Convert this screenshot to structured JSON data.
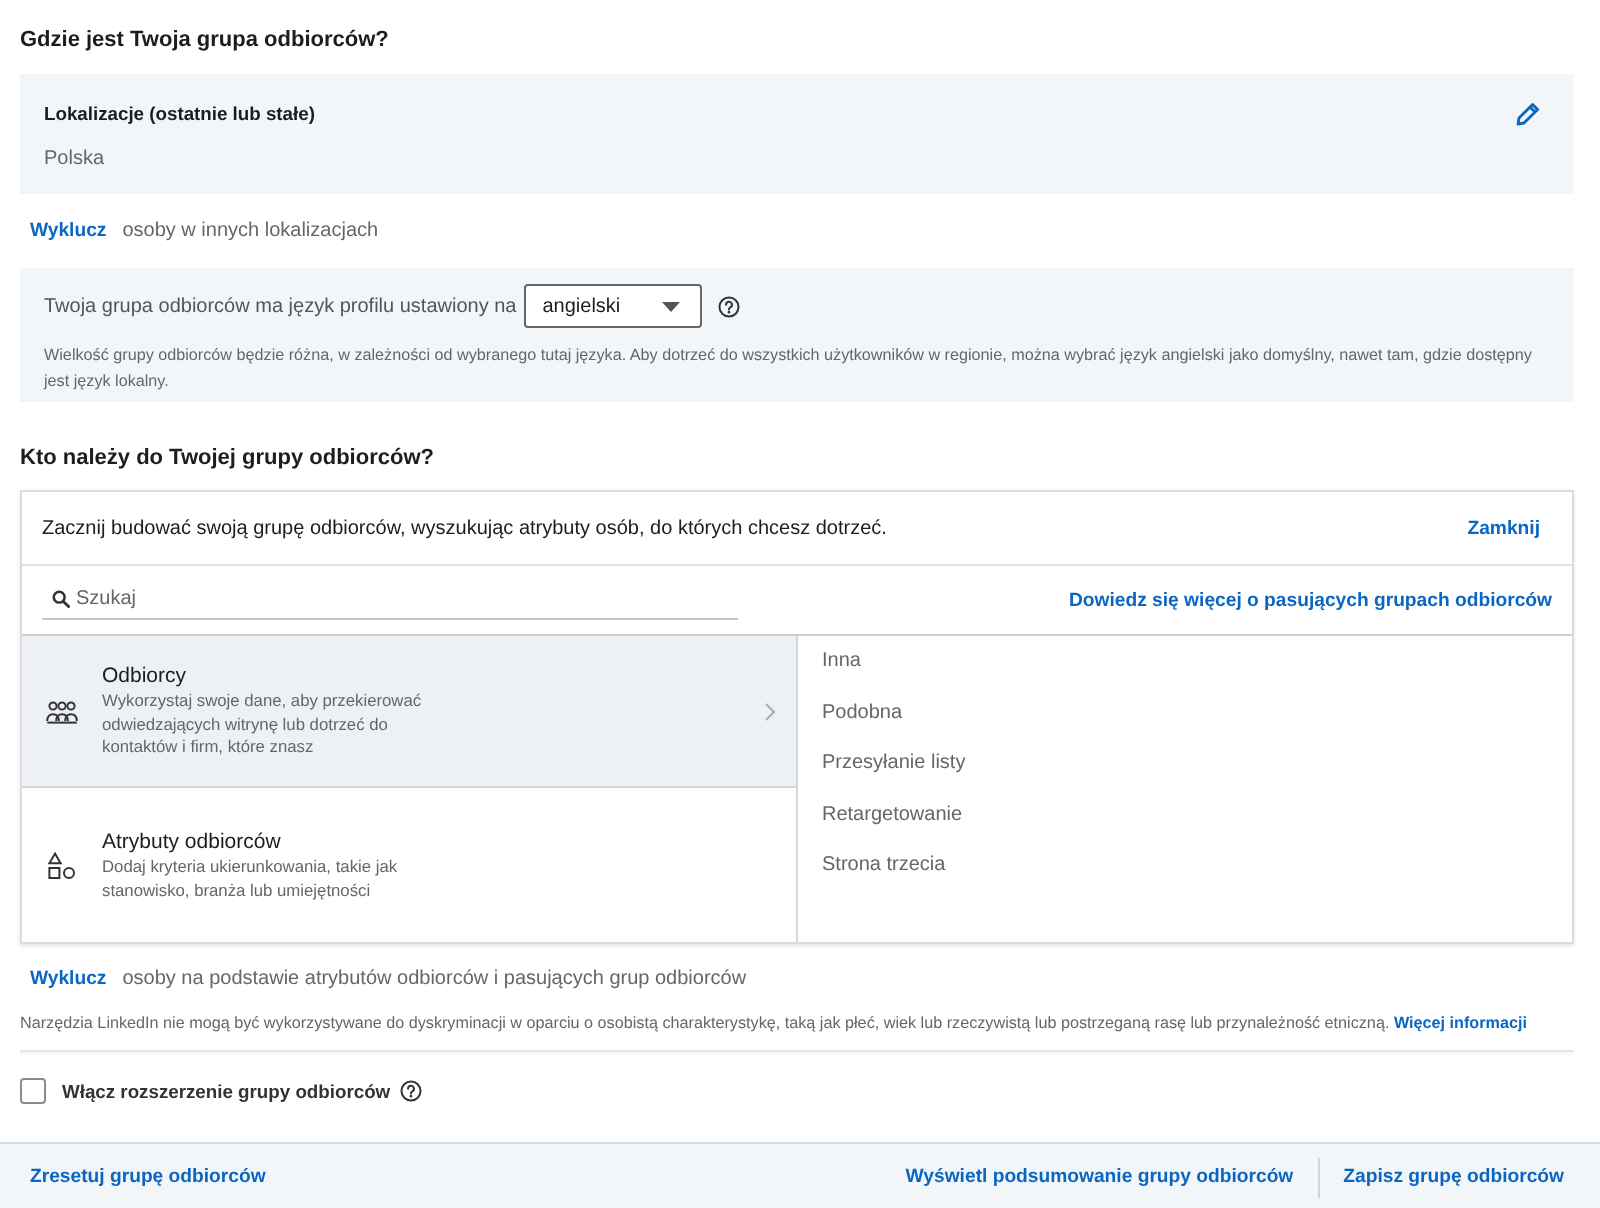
{
  "location_section": {
    "title": "Gdzie jest Twoja grupa odbiorców?",
    "panel": {
      "label": "Lokalizacje (ostatnie lub stałe)",
      "value": "Polska"
    },
    "exclude": {
      "link": "Wyklucz",
      "text": "osoby w innych lokalizacjach"
    },
    "language": {
      "label": "Twoja grupa odbiorców ma język profilu ustawiony na",
      "select_value": "angielski",
      "note": "Wielkość grupy odbiorców będzie różna, w zależności od wybranego tutaj języka. Aby dotrzeć do wszystkich użytkowników w regionie, można wybrać język angielski jako domyślny, nawet tam, gdzie dostępny jest język lokalny."
    }
  },
  "audience_section": {
    "title": "Kto należy do Twojej grupy odbiorców?",
    "card": {
      "intro": "Zacznij budować swoją grupę odbiorców, wyszukując atrybuty osób, do których chcesz dotrzeć.",
      "close_link": "Zamknij",
      "search": {
        "placeholder": "Szukaj"
      },
      "learn_more_link": "Dowiedz się więcej o pasujących grupach odbiorców",
      "categories": [
        {
          "kind": "audiences",
          "title": "Odbiorcy",
          "description": "Wykorzystaj swoje dane, aby przekierować odwiedzających witrynę lub dotrzeć do kontaktów i firm, które znasz",
          "selected": true
        },
        {
          "kind": "attributes",
          "title": "Atrybuty odbiorców",
          "description": "Dodaj kryteria ukierunkowania, takie jak stanowisko, branża lub umiejętności",
          "selected": false
        }
      ],
      "subcategories": [
        "Inna",
        "Podobna",
        "Przesyłanie listy",
        "Retargetowanie",
        "Strona trzecia"
      ]
    },
    "exclude": {
      "link": "Wyklucz",
      "text": "osoby na podstawie atrybutów odbiorców i pasujących grup odbiorców"
    }
  },
  "disclaimer": {
    "text": "Narzędzia LinkedIn nie mogą być wykorzystywane do dyskryminacji w oparciu o osobistą charakterystykę, taką jak płeć, wiek lub rzeczywistą lub postrzeganą rasę lub przynależność etniczną.",
    "link": "Więcej informacji"
  },
  "expansion": {
    "label": "Włącz rozszerzenie grupy odbiorców",
    "checked": false
  },
  "footer": {
    "reset": "Zresetuj grupę odbiorców",
    "summary": "Wyświetl podsumowanie grupy odbiorców",
    "save": "Zapisz grupę odbiorców"
  }
}
